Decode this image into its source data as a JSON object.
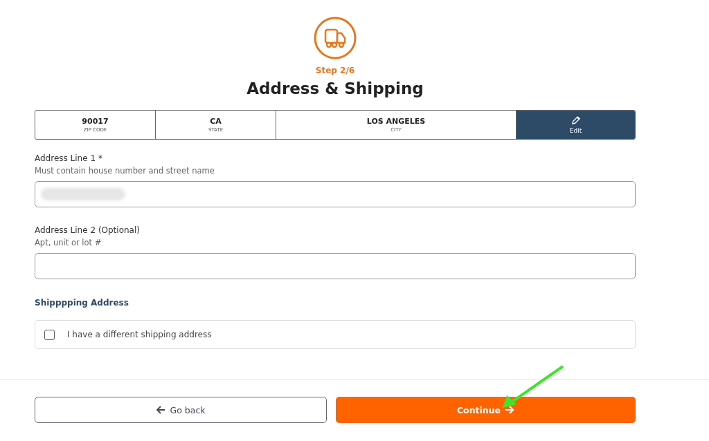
{
  "header": {
    "step": "Step 2/6",
    "title": "Address & Shipping"
  },
  "location": [
    {
      "value": "90017",
      "label": "ZIP CODE"
    },
    {
      "value": "CA",
      "label": "STATE"
    },
    {
      "value": "LOS ANGELES",
      "label": "CITY"
    }
  ],
  "edit_button": {
    "label": "Edit"
  },
  "fields": [
    {
      "label": "Address Line 1 *",
      "hint": "Must contain house number and street name",
      "redacted": true
    },
    {
      "label": "Address Line 2 (Optional)",
      "hint": "Apt, unit or lot #",
      "redacted": false
    }
  ],
  "shipping": {
    "heading": "Shipppping Address",
    "option": {
      "label": "I have a different shipping address",
      "checked": false
    }
  },
  "buttons": {
    "back": "Go back",
    "continue": "Continue"
  }
}
